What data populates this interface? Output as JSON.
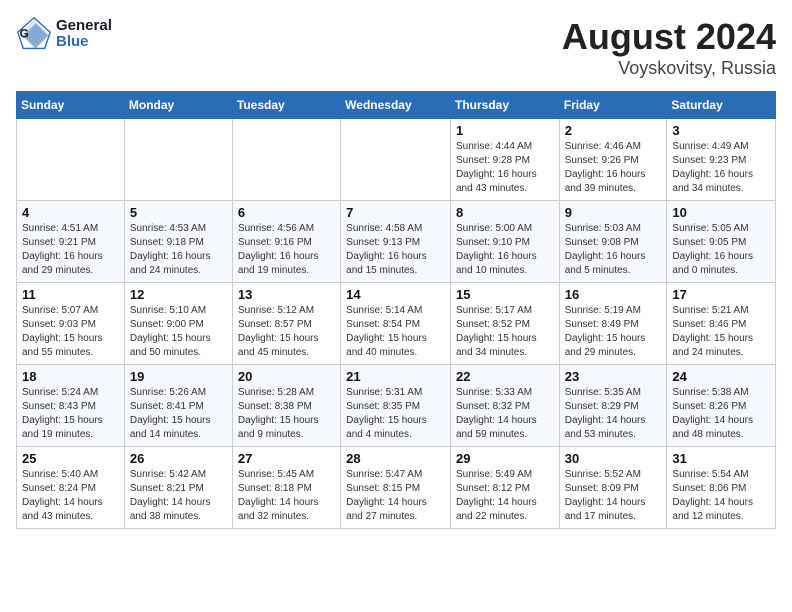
{
  "logo": {
    "line1": "General",
    "line2": "Blue"
  },
  "title": "August 2024",
  "location": "Voyskovitsy, Russia",
  "days_of_week": [
    "Sunday",
    "Monday",
    "Tuesday",
    "Wednesday",
    "Thursday",
    "Friday",
    "Saturday"
  ],
  "weeks": [
    [
      {
        "day": "",
        "info": ""
      },
      {
        "day": "",
        "info": ""
      },
      {
        "day": "",
        "info": ""
      },
      {
        "day": "",
        "info": ""
      },
      {
        "day": "1",
        "info": "Sunrise: 4:44 AM\nSunset: 9:28 PM\nDaylight: 16 hours and 43 minutes."
      },
      {
        "day": "2",
        "info": "Sunrise: 4:46 AM\nSunset: 9:26 PM\nDaylight: 16 hours and 39 minutes."
      },
      {
        "day": "3",
        "info": "Sunrise: 4:49 AM\nSunset: 9:23 PM\nDaylight: 16 hours and 34 minutes."
      }
    ],
    [
      {
        "day": "4",
        "info": "Sunrise: 4:51 AM\nSunset: 9:21 PM\nDaylight: 16 hours and 29 minutes."
      },
      {
        "day": "5",
        "info": "Sunrise: 4:53 AM\nSunset: 9:18 PM\nDaylight: 16 hours and 24 minutes."
      },
      {
        "day": "6",
        "info": "Sunrise: 4:56 AM\nSunset: 9:16 PM\nDaylight: 16 hours and 19 minutes."
      },
      {
        "day": "7",
        "info": "Sunrise: 4:58 AM\nSunset: 9:13 PM\nDaylight: 16 hours and 15 minutes."
      },
      {
        "day": "8",
        "info": "Sunrise: 5:00 AM\nSunset: 9:10 PM\nDaylight: 16 hours and 10 minutes."
      },
      {
        "day": "9",
        "info": "Sunrise: 5:03 AM\nSunset: 9:08 PM\nDaylight: 16 hours and 5 minutes."
      },
      {
        "day": "10",
        "info": "Sunrise: 5:05 AM\nSunset: 9:05 PM\nDaylight: 16 hours and 0 minutes."
      }
    ],
    [
      {
        "day": "11",
        "info": "Sunrise: 5:07 AM\nSunset: 9:03 PM\nDaylight: 15 hours and 55 minutes."
      },
      {
        "day": "12",
        "info": "Sunrise: 5:10 AM\nSunset: 9:00 PM\nDaylight: 15 hours and 50 minutes."
      },
      {
        "day": "13",
        "info": "Sunrise: 5:12 AM\nSunset: 8:57 PM\nDaylight: 15 hours and 45 minutes."
      },
      {
        "day": "14",
        "info": "Sunrise: 5:14 AM\nSunset: 8:54 PM\nDaylight: 15 hours and 40 minutes."
      },
      {
        "day": "15",
        "info": "Sunrise: 5:17 AM\nSunset: 8:52 PM\nDaylight: 15 hours and 34 minutes."
      },
      {
        "day": "16",
        "info": "Sunrise: 5:19 AM\nSunset: 8:49 PM\nDaylight: 15 hours and 29 minutes."
      },
      {
        "day": "17",
        "info": "Sunrise: 5:21 AM\nSunset: 8:46 PM\nDaylight: 15 hours and 24 minutes."
      }
    ],
    [
      {
        "day": "18",
        "info": "Sunrise: 5:24 AM\nSunset: 8:43 PM\nDaylight: 15 hours and 19 minutes."
      },
      {
        "day": "19",
        "info": "Sunrise: 5:26 AM\nSunset: 8:41 PM\nDaylight: 15 hours and 14 minutes."
      },
      {
        "day": "20",
        "info": "Sunrise: 5:28 AM\nSunset: 8:38 PM\nDaylight: 15 hours and 9 minutes."
      },
      {
        "day": "21",
        "info": "Sunrise: 5:31 AM\nSunset: 8:35 PM\nDaylight: 15 hours and 4 minutes."
      },
      {
        "day": "22",
        "info": "Sunrise: 5:33 AM\nSunset: 8:32 PM\nDaylight: 14 hours and 59 minutes."
      },
      {
        "day": "23",
        "info": "Sunrise: 5:35 AM\nSunset: 8:29 PM\nDaylight: 14 hours and 53 minutes."
      },
      {
        "day": "24",
        "info": "Sunrise: 5:38 AM\nSunset: 8:26 PM\nDaylight: 14 hours and 48 minutes."
      }
    ],
    [
      {
        "day": "25",
        "info": "Sunrise: 5:40 AM\nSunset: 8:24 PM\nDaylight: 14 hours and 43 minutes."
      },
      {
        "day": "26",
        "info": "Sunrise: 5:42 AM\nSunset: 8:21 PM\nDaylight: 14 hours and 38 minutes."
      },
      {
        "day": "27",
        "info": "Sunrise: 5:45 AM\nSunset: 8:18 PM\nDaylight: 14 hours and 32 minutes."
      },
      {
        "day": "28",
        "info": "Sunrise: 5:47 AM\nSunset: 8:15 PM\nDaylight: 14 hours and 27 minutes."
      },
      {
        "day": "29",
        "info": "Sunrise: 5:49 AM\nSunset: 8:12 PM\nDaylight: 14 hours and 22 minutes."
      },
      {
        "day": "30",
        "info": "Sunrise: 5:52 AM\nSunset: 8:09 PM\nDaylight: 14 hours and 17 minutes."
      },
      {
        "day": "31",
        "info": "Sunrise: 5:54 AM\nSunset: 8:06 PM\nDaylight: 14 hours and 12 minutes."
      }
    ]
  ]
}
